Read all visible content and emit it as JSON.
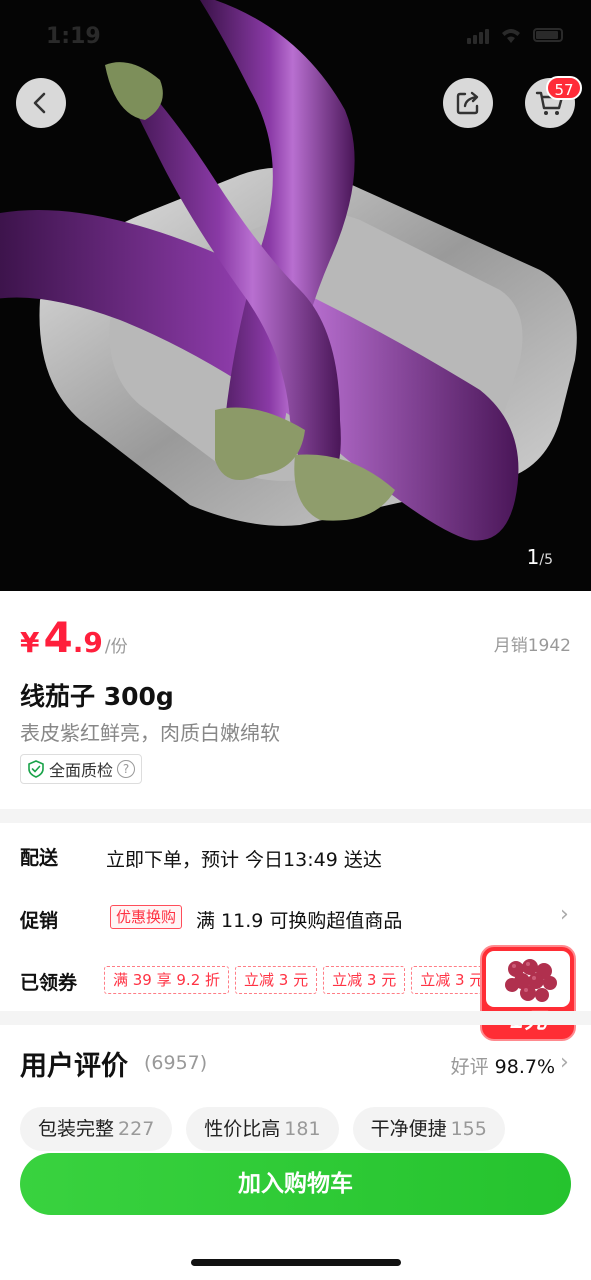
{
  "status": {
    "time": "1:19"
  },
  "header": {
    "back_icon": "chevron-left-icon",
    "share_icon": "share-icon",
    "cart_icon": "cart-icon",
    "cart_badge": "57"
  },
  "gallery": {
    "current": "1",
    "total": "/5"
  },
  "product": {
    "price_symbol": "¥",
    "price_int": "4",
    "price_dec": ".9",
    "price_unit": "/份",
    "monthly_sales": "月销1942",
    "title": "线茄子 300g",
    "subtitle": "表皮紫红鲜亮，肉质白嫩绵软",
    "qc_label": "全面质检",
    "qc_help": "?"
  },
  "delivery": {
    "label": "配送",
    "text": "立即下单，预计 今日13:49 送达"
  },
  "promotion": {
    "label": "促销",
    "tag": "优惠换购",
    "text": "满 11.9 可换购超值商品"
  },
  "coupons": {
    "label": "已领券",
    "items": [
      "满 39 享 9.2 折",
      "立减 3 元",
      "立减 3 元",
      "立减 3 元"
    ]
  },
  "floating_promo": {
    "label": "1元"
  },
  "reviews": {
    "title": "用户评价",
    "count": "(6957)",
    "rate_label": "好评",
    "rate_value": "98.7%",
    "tags": [
      {
        "label": "包装完整",
        "count": "227"
      },
      {
        "label": "性价比高",
        "count": "181"
      },
      {
        "label": "干净便捷",
        "count": "155"
      }
    ]
  },
  "actions": {
    "add_to_cart": "加入购物车"
  },
  "colors": {
    "price": "#ff1f3c",
    "cta": "#2ec935",
    "badge": "#ff2b38"
  }
}
